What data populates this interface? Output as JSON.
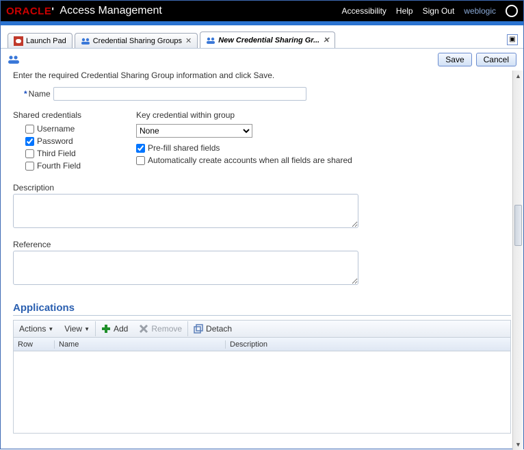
{
  "header": {
    "brand_left": "ORACLE",
    "brand_right": "Access Management",
    "links": {
      "accessibility": "Accessibility",
      "help": "Help",
      "signout": "Sign Out"
    },
    "user": "weblogic"
  },
  "tabs": {
    "launch": "Launch Pad",
    "groups": "Credential Sharing Groups",
    "new": "New Credential Sharing Gr..."
  },
  "buttons": {
    "save": "Save",
    "cancel": "Cancel"
  },
  "form": {
    "intro": "Enter the required Credential Sharing Group information and click Save.",
    "name_label": "Name",
    "name_value": "",
    "shared_heading": "Shared credentials",
    "shared": {
      "username": {
        "label": "Username",
        "checked": false
      },
      "password": {
        "label": "Password",
        "checked": true
      },
      "third": {
        "label": "Third Field",
        "checked": false
      },
      "fourth": {
        "label": "Fourth Field",
        "checked": false
      }
    },
    "key_heading": "Key credential within group",
    "key_value": "None",
    "prefill": {
      "label": "Pre-fill shared fields",
      "checked": true
    },
    "auto": {
      "label": "Automatically create accounts when all fields are shared",
      "checked": false
    },
    "description_label": "Description",
    "description_value": "",
    "reference_label": "Reference",
    "reference_value": ""
  },
  "applications": {
    "heading": "Applications",
    "toolbar": {
      "actions": "Actions",
      "view": "View",
      "add": "Add",
      "remove": "Remove",
      "detach": "Detach"
    },
    "columns": {
      "row": "Row",
      "name": "Name",
      "description": "Description"
    },
    "rows": []
  }
}
